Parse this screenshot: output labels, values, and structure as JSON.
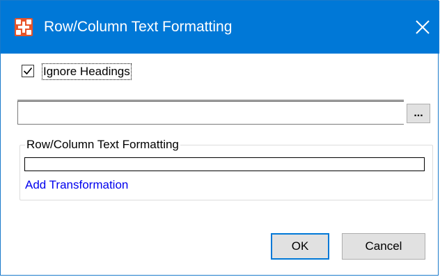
{
  "window": {
    "title": "Row/Column Text Formatting",
    "accent_color": "#0078d7",
    "app_icon": "app-logo-icon",
    "close_icon": "close-icon"
  },
  "options": {
    "ignore_headings_label": "Ignore Headings",
    "ignore_headings_checked": true
  },
  "path_field": {
    "value": "",
    "browse_label": "..."
  },
  "group": {
    "legend": "Row/Column Text Formatting",
    "add_link": "Add Transformation",
    "link_color": "#0000ee"
  },
  "buttons": {
    "ok": "OK",
    "cancel": "Cancel"
  }
}
